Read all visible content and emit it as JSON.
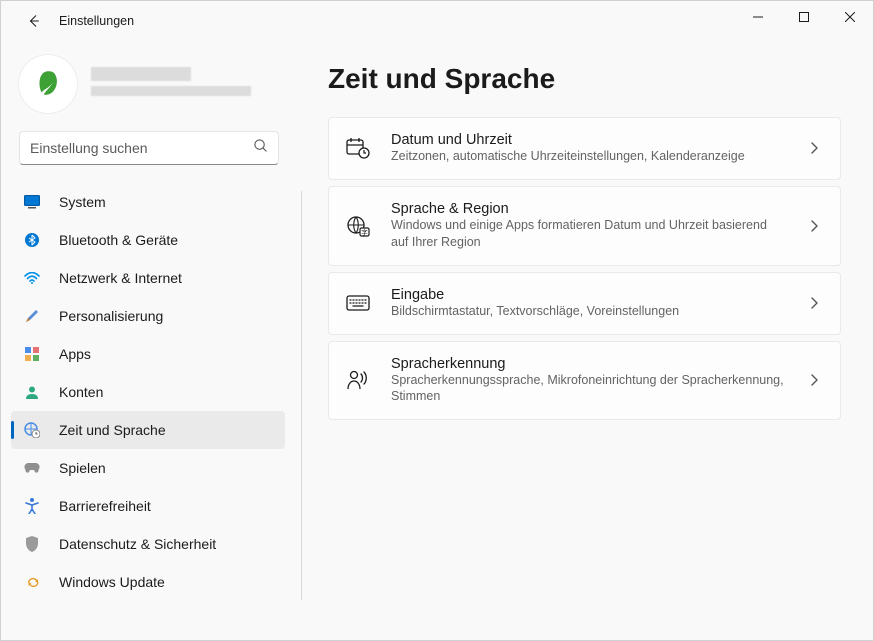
{
  "window": {
    "title": "Einstellungen"
  },
  "search": {
    "placeholder": "Einstellung suchen"
  },
  "sidebar": {
    "items": [
      {
        "label": "System"
      },
      {
        "label": "Bluetooth & Geräte"
      },
      {
        "label": "Netzwerk & Internet"
      },
      {
        "label": "Personalisierung"
      },
      {
        "label": "Apps"
      },
      {
        "label": "Konten"
      },
      {
        "label": "Zeit und Sprache"
      },
      {
        "label": "Spielen"
      },
      {
        "label": "Barrierefreiheit"
      },
      {
        "label": "Datenschutz & Sicherheit"
      },
      {
        "label": "Windows Update"
      }
    ]
  },
  "main": {
    "title": "Zeit und Sprache",
    "cards": [
      {
        "title": "Datum und Uhrzeit",
        "sub": "Zeitzonen, automatische Uhrzeiteinstellungen, Kalenderanzeige"
      },
      {
        "title": "Sprache & Region",
        "sub": "Windows und einige Apps formatieren Datum und Uhrzeit basierend auf Ihrer Region"
      },
      {
        "title": "Eingabe",
        "sub": "Bildschirmtastatur, Textvorschläge, Voreinstellungen"
      },
      {
        "title": "Spracherkennung",
        "sub": "Spracherkennungssprache, Mikrofoneinrichtung der Spracherkennung, Stimmen"
      }
    ]
  }
}
